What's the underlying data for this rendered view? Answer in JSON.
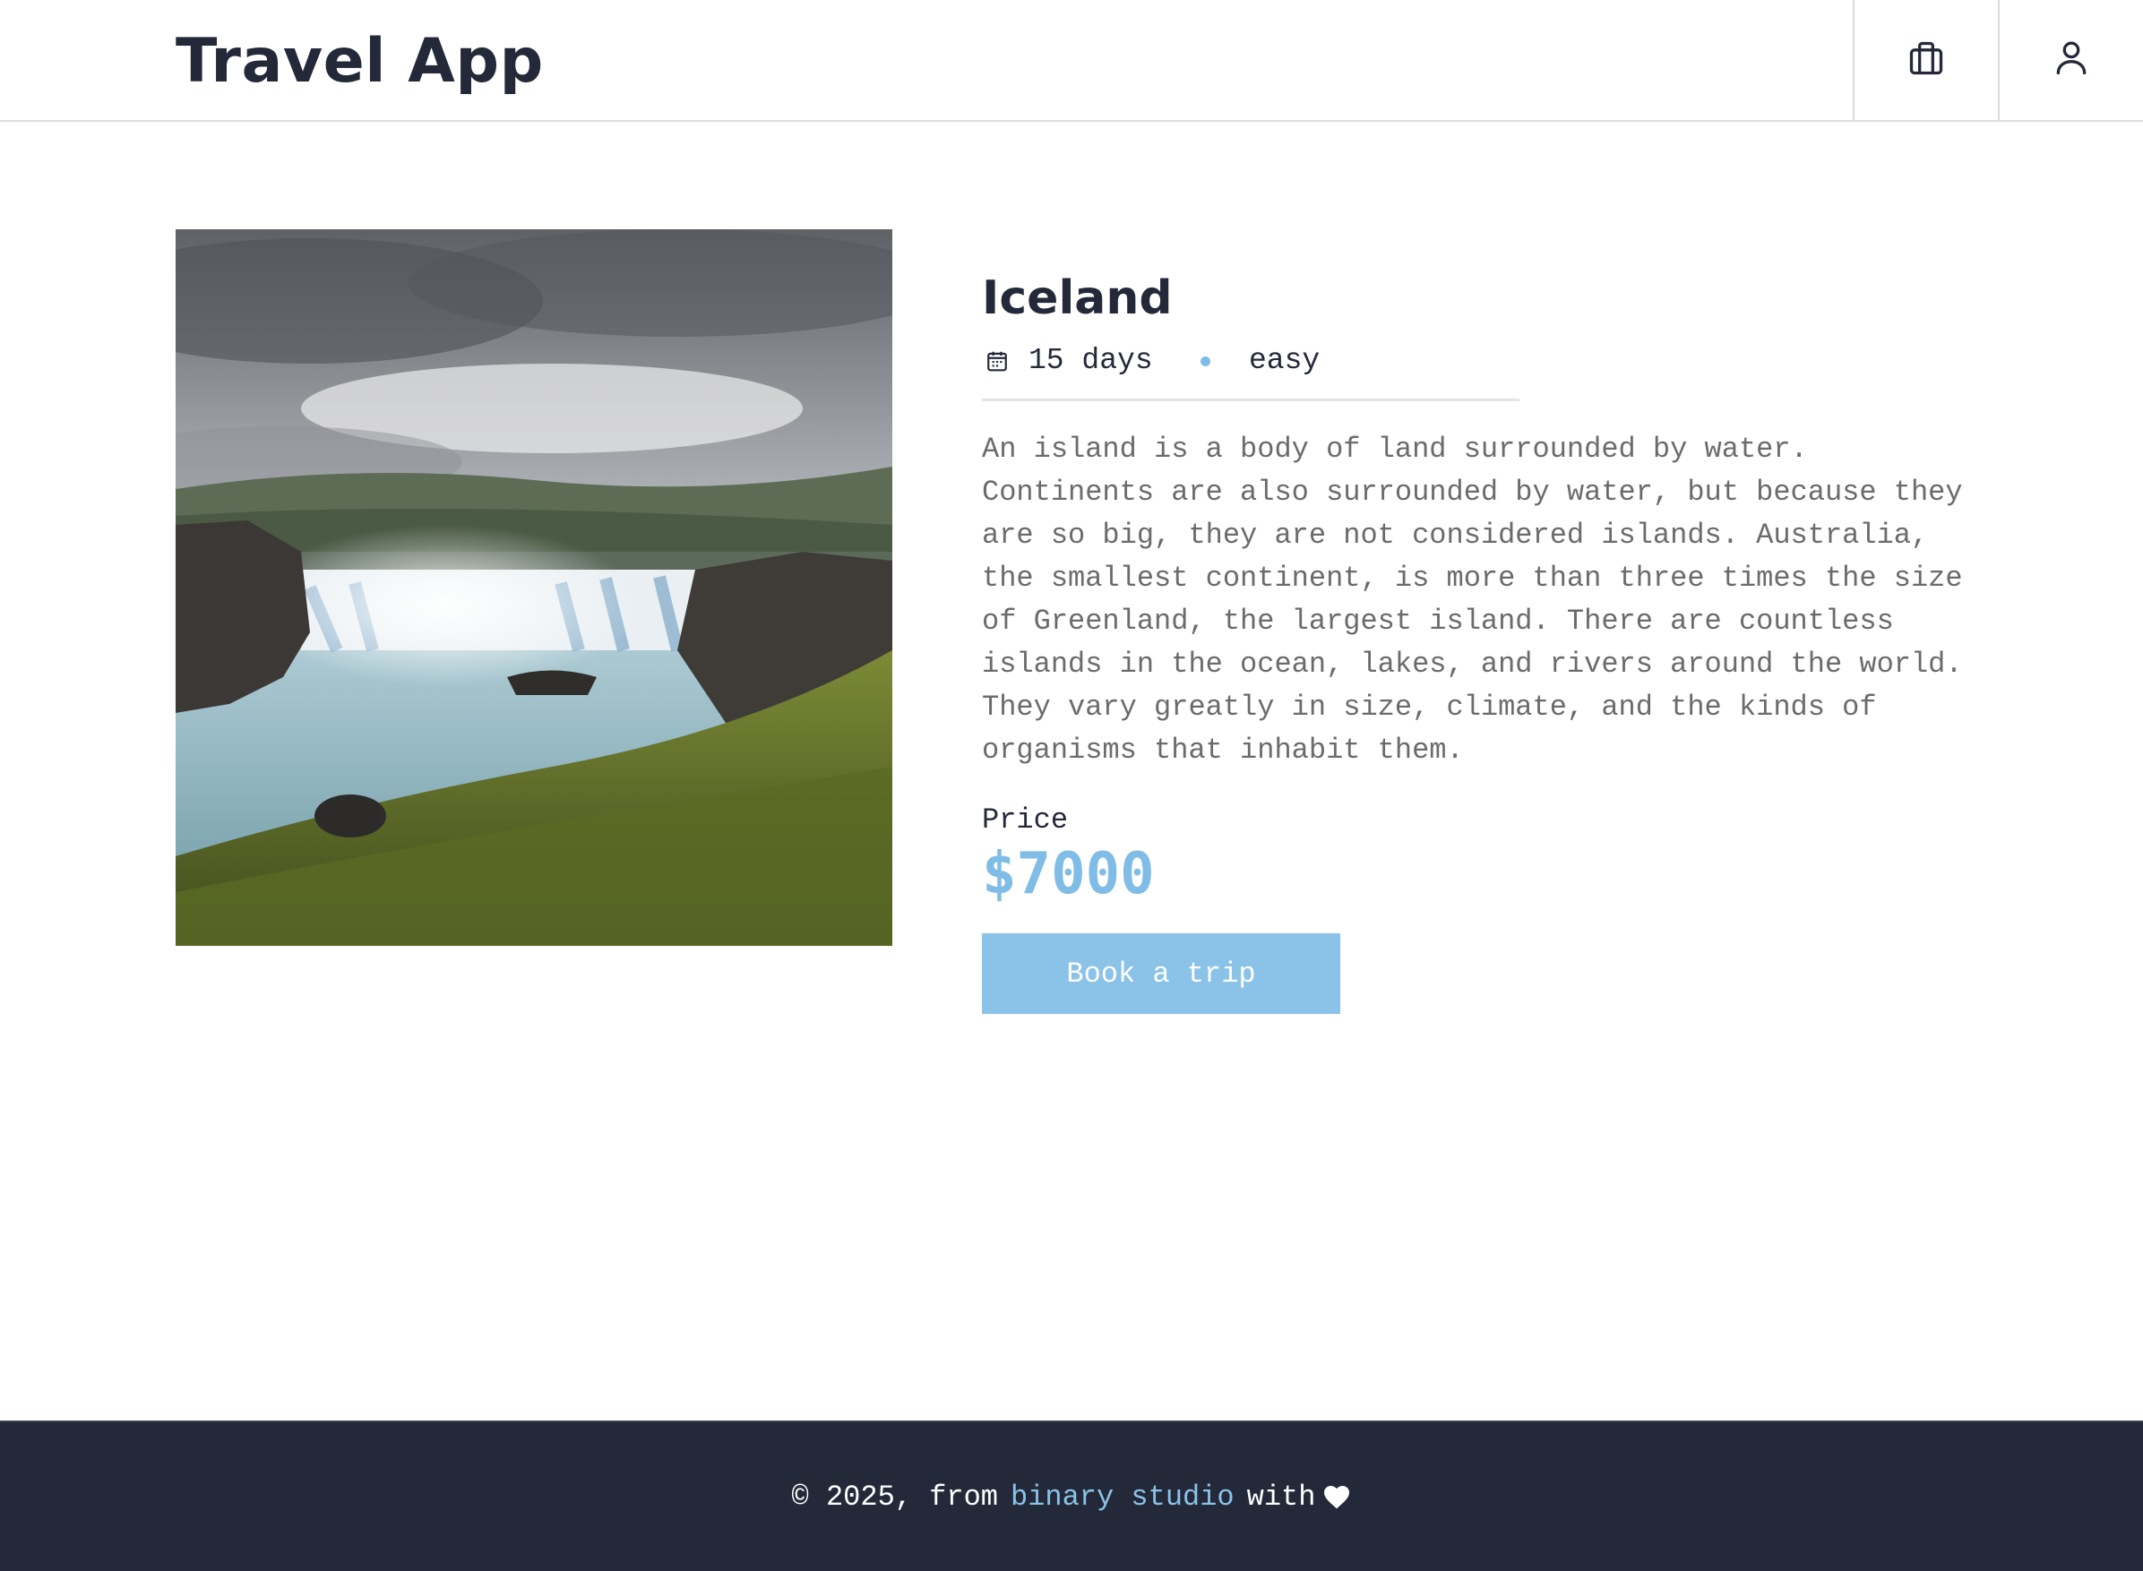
{
  "header": {
    "title": "Travel App",
    "bookings_icon": "briefcase-icon",
    "profile_icon": "user-icon"
  },
  "trip": {
    "image": "waterfall-landscape-photo",
    "title": "Iceland",
    "duration": "15 days",
    "level": "easy",
    "description": "An island is a body of land surrounded by water.\nContinents are also surrounded by water, but because they\nare so big, they are not considered islands. Australia,\nthe smallest continent, is more than three times the size\nof Greenland, the largest island. There are countless\nislands in the ocean, lakes, and rivers around the world.\nThey vary greatly in size, climate, and the kinds of\norganisms that inhabit them.",
    "price_label": "Price",
    "price": "$7000",
    "book_label": "Book a trip"
  },
  "footer": {
    "prefix": "© 2025, from",
    "link_text": "binary studio",
    "suffix": "with",
    "heart_icon": "heart-icon"
  },
  "colors": {
    "dark": "#232938",
    "accent": "#7fbde6",
    "button": "#8ac2e8",
    "text_muted": "#6b6b6b"
  }
}
